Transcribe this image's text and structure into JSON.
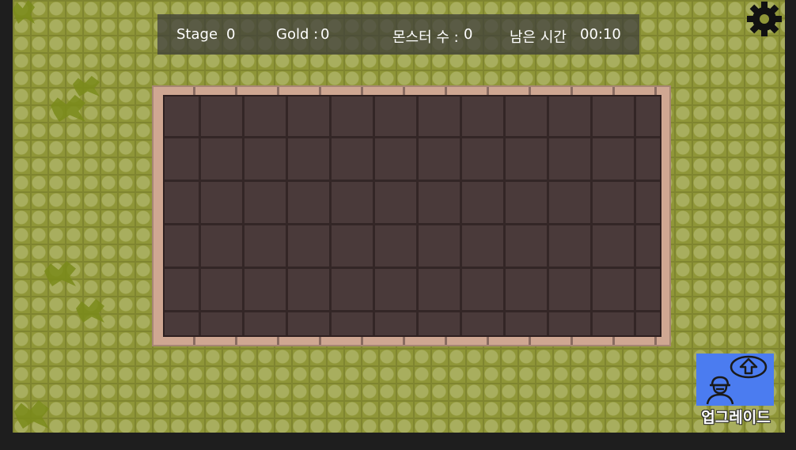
{
  "hud": {
    "stage_label": "Stage",
    "stage_value": "0",
    "gold_label": "Gold :",
    "gold_value": "0",
    "monster_label": "몬스터 수 :",
    "monster_value": "0",
    "time_label": "남은 시간",
    "time_value": "00:10"
  },
  "upgrade": {
    "label": "업그레이드",
    "icon": "upgrade-arrow-icon"
  },
  "settings": {
    "icon": "gear-icon"
  },
  "colors": {
    "ground": "#8f9638",
    "board": "#4a3a3a",
    "board_frame": "#cfa792",
    "upgrade_button": "#4b7cf0"
  }
}
